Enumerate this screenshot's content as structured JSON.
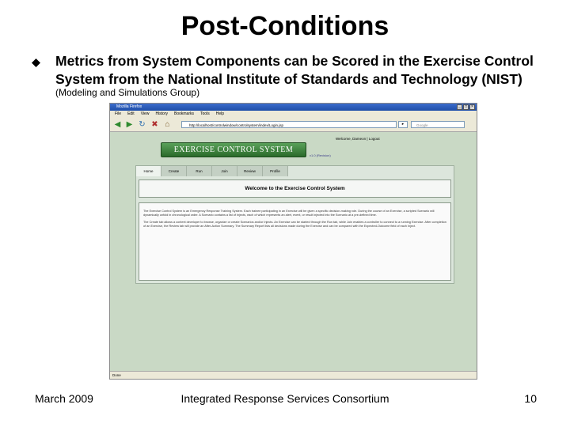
{
  "slide": {
    "title": "Post-Conditions",
    "bullet": "Metrics from System Components can be Scored in the Exercise Control System from the National Institute of Standards and Technology (NIST)",
    "sub_bullet": "(Modeling and Simulations Group)"
  },
  "footer": {
    "date": "March 2009",
    "organization": "Integrated Response Services Consortium",
    "page_number": "10"
  },
  "browser": {
    "title": "Mozilla Firefox",
    "menu": [
      "File",
      "Edit",
      "View",
      "History",
      "Bookmarks",
      "Tools",
      "Help"
    ],
    "url": "http://localhost/controlwindow/controlsystem/index/Login.jsp",
    "search_placeholder": "Google",
    "status": "Done",
    "page": {
      "welcome_user": "Welcome, Dameon | Logout",
      "banner": "EXERCISE CONTROL SYSTEM",
      "version": "v1.0 (Revision)",
      "tabs": [
        "Home",
        "Create",
        "Run",
        "Join",
        "Review",
        "Profile"
      ],
      "welcome_heading": "Welcome to the Exercise Control System",
      "paragraph_1": "The Exercise Control System is an Emergency Response Training System. Each trainee participating in an Exercise will be given a specific decision-making role. During the course of an Exercise, a scripted Scenario will dynamically unfold in chronological order. A Scenario contains a list of Injects, each of which represents an alert, event, or result injected into the Scenario at a pre-defined time.",
      "paragraph_2": "The Create tab allows a content developer to browse, organize or create Scenarios and/or Injects. An Exercise can be started through the Run tab, while Join enables a controller to connect to a running Exercise. After completion of an Exercise, the Review tab will provide an After-Action Summary. The Summary Report lists all decisions made during the Exercise and can be compared with the Expected-Outcome field of each Inject."
    }
  },
  "colors": {
    "browser_bg": "#c9d9c5",
    "banner_green": "#2a6a2a",
    "titlebar_blue": "#1f4ea8"
  }
}
